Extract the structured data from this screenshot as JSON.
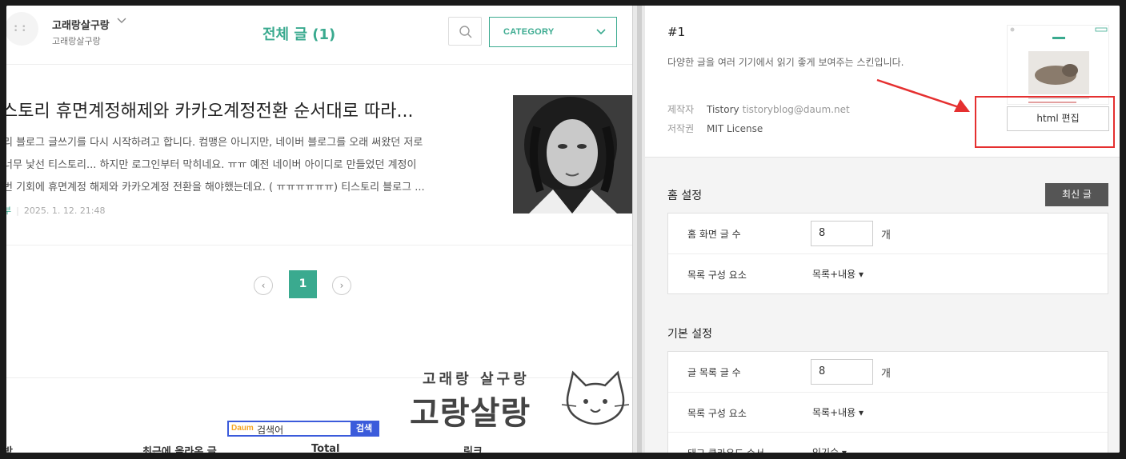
{
  "header": {
    "blog_name": "고래랑살구랑",
    "blog_subtitle": "고래랑살구랑",
    "page_title": "전체 글 (1)",
    "category_label": "CATEGORY"
  },
  "post": {
    "title": "스토리 휴면계정해제와 카카오계정전환 순서대로 따라...",
    "excerpt": [
      "리 블로그 글쓰기를 다시 시작하려고 합니다. 컴맹은 아니지만, 네이버 블로그를 오래 써왔던 저로",
      "너무 낯선  티스토리...  하지만 로그인부터 막히네요. ㅠㅠ   예전 네이버 아이디로 만들었던 계정이",
      "번 기회에 휴면계정 해제와 카카오계정 전환을 해야했는데요. ( ㅠㅠㅠㅠㅠㅠ) 티스토리 블로그 ..."
    ],
    "category": "부",
    "date": "2025. 1. 12. 21:48"
  },
  "pagination": {
    "prev": "‹",
    "current": "1",
    "next": "›"
  },
  "footer": {
    "search_logo": "Daum",
    "search_value": "검색어",
    "search_button": "검색",
    "headings": [
      "방",
      "최근에 올라온 글",
      "Total",
      "링크"
    ]
  },
  "watermark": {
    "small": "고래랑 살구랑",
    "big": "고랑살랑"
  },
  "skin": {
    "number": "#1",
    "description": "다양한 글을 여러 기기에서 읽기 좋게 보여주는 스킨입니다.",
    "maker_key": "제작자",
    "maker_value": "Tistory",
    "maker_email": "tistoryblog@daum.net",
    "license_key": "저작권",
    "license_value": "MIT License",
    "html_edit_label": "html 편집"
  },
  "home_settings": {
    "title": "홈 설정",
    "latest_button": "최신 글",
    "rows": [
      {
        "label": "홈 화면 글 수",
        "value": "8",
        "unit": "개"
      },
      {
        "label": "목록 구성 요소",
        "value": "목록+내용 ▾"
      }
    ]
  },
  "basic_settings": {
    "title": "기본 설정",
    "rows": [
      {
        "label": "글 목록 글 수",
        "value": "8",
        "unit": "개"
      },
      {
        "label": "목록 구성 요소",
        "value": "목록+내용 ▾"
      },
      {
        "label": "태그 클라우드 순서",
        "value": "인기순 ▾"
      }
    ]
  },
  "colors": {
    "accent": "#3aaa8f",
    "highlight": "#e53030",
    "dark_button": "#555555"
  }
}
